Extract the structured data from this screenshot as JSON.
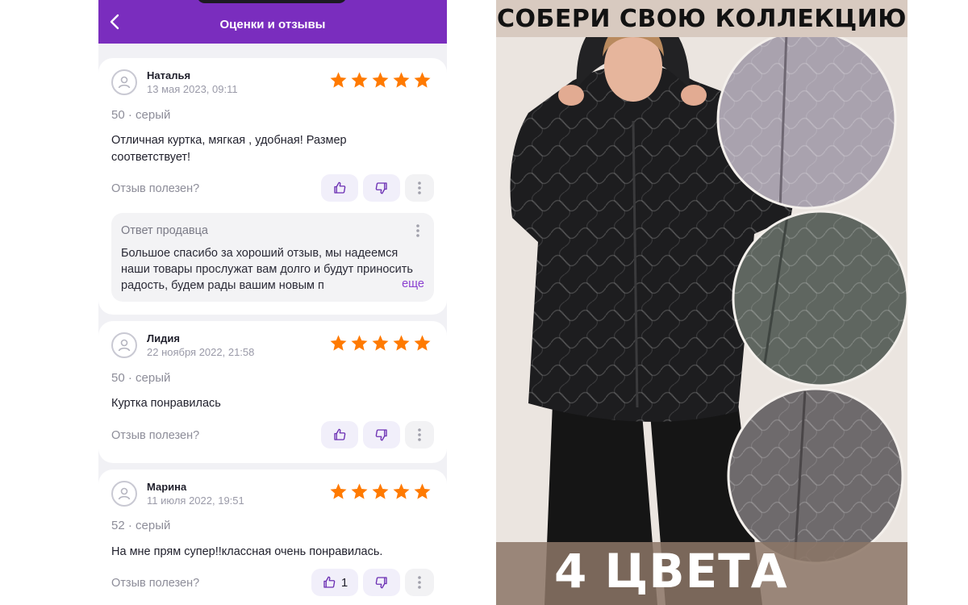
{
  "header": {
    "title": "Оценки и отзывы"
  },
  "reviews": [
    {
      "name": "Наталья",
      "date": "13 мая 2023, 09:11",
      "variant": "50 · серый",
      "text": "Отличная куртка, мягкая , удобная! Размер соответствует!",
      "helpful_label": "Отзыв полезен?",
      "likes": "",
      "rating": 5
    },
    {
      "name": "Лидия",
      "date": "22 ноября 2022, 21:58",
      "variant": "50 · серый",
      "text": "Куртка понравилась",
      "helpful_label": "Отзыв полезен?",
      "likes": "",
      "rating": 5
    },
    {
      "name": "Марина",
      "date": "11 июля 2022, 19:51",
      "variant": "52 · серый",
      "text": "На мне прям супер!!классная очень понравилась.",
      "helpful_label": "Отзыв полезен?",
      "likes": "1",
      "rating": 5
    }
  ],
  "seller_reply": {
    "title": "Ответ продавца",
    "text": "Большое спасибо за хороший отзыв, мы надеемся наши товары прослужат вам долго и будут приносить радость, будем рады вашим новым п",
    "expand": "еще"
  },
  "promo": {
    "headline": "СОБЕРИ СВОЮ КОЛЛЕКЦИЮ",
    "colors": "4 ЦВЕТА"
  },
  "colors": {
    "header_bg": "#7a2dbe",
    "star": "#ff7a00",
    "accent": "#6b2fb3",
    "jacket_gray": "#a9a2ae",
    "jacket_olive": "#5f6660",
    "jacket_graphite": "#6e6a6c"
  },
  "icons": [
    "back-arrow-icon",
    "user-avatar-icon",
    "star-icon",
    "thumbs-up-icon",
    "thumbs-down-icon",
    "more-vertical-icon"
  ]
}
